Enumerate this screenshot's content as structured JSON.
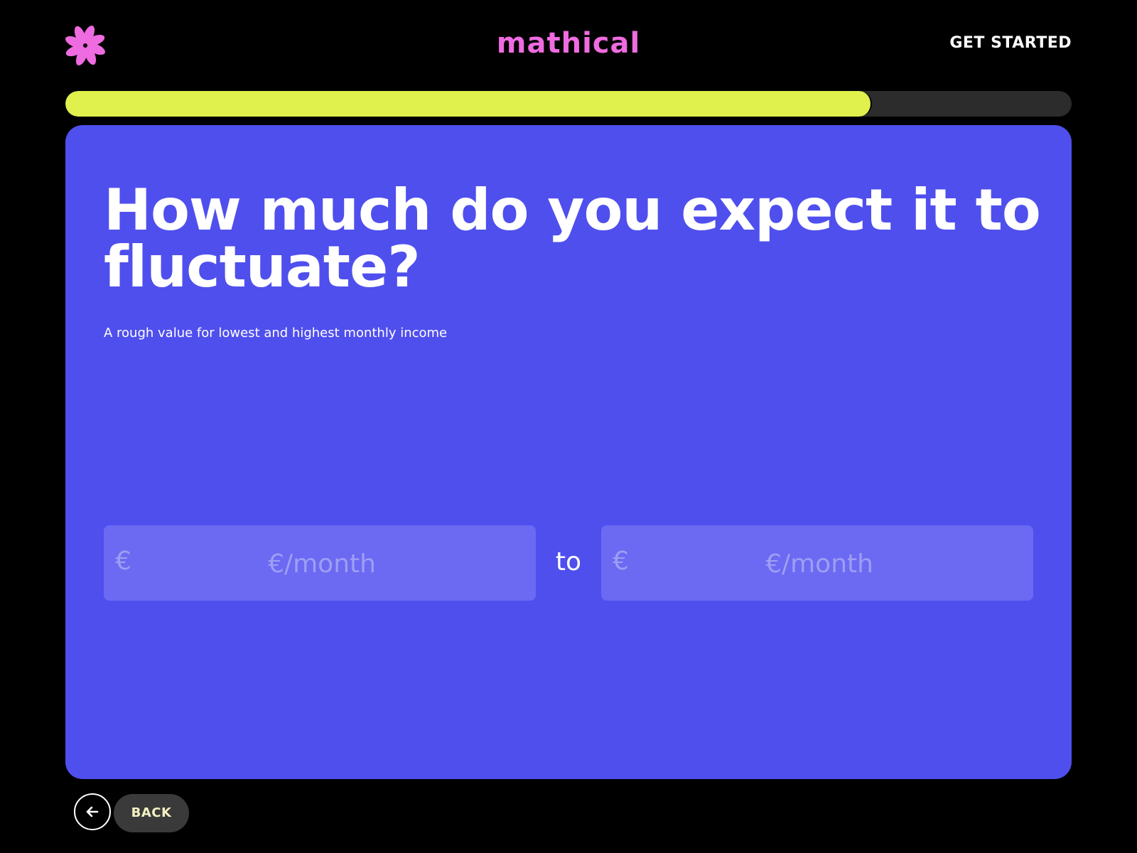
{
  "header": {
    "brand": "mathical",
    "cta_label": "GET STARTED",
    "logo_icon": "flower-icon",
    "brand_color": "#ee6be0"
  },
  "progress": {
    "fraction": 0.8,
    "fill_color": "#e0f04c",
    "track_color": "#2c2c2c"
  },
  "question": {
    "title": "How much do you expect it to fluctuate?",
    "subtitle": "A rough value for lowest and highest monthly income",
    "card_color": "#4f4fee"
  },
  "range": {
    "low": {
      "currency_symbol": "€",
      "placeholder": "€/month",
      "value": ""
    },
    "separator": "to",
    "high": {
      "currency_symbol": "€",
      "placeholder": "€/month",
      "value": ""
    }
  },
  "footer": {
    "back_label": "BACK",
    "back_icon": "arrow-left-icon"
  }
}
